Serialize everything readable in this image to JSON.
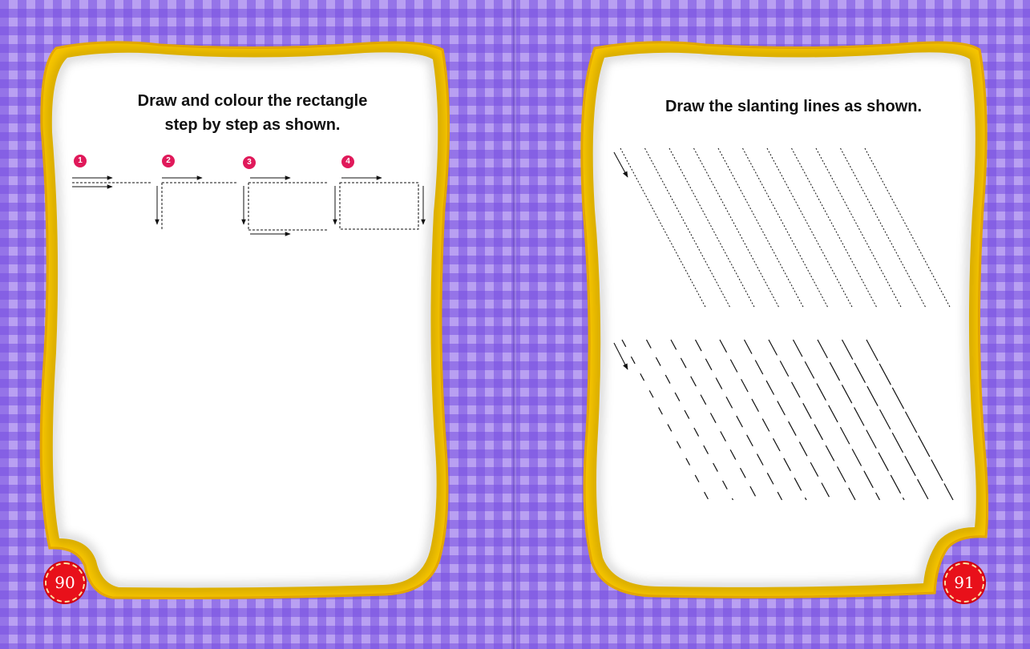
{
  "left_page": {
    "instruction": "Draw and colour the rectangle\nstep by step as shown.",
    "steps": [
      "1",
      "2",
      "3",
      "4"
    ],
    "page_number": "90"
  },
  "right_page": {
    "instruction": "Draw the slanting lines as shown.",
    "page_number": "91"
  },
  "colors": {
    "background_purple": "#b9a0f2",
    "frame_yellow": "#f7c500",
    "page_white": "#ffffff",
    "badge_red": "#e8101a",
    "step_pink": "#e0195a"
  }
}
